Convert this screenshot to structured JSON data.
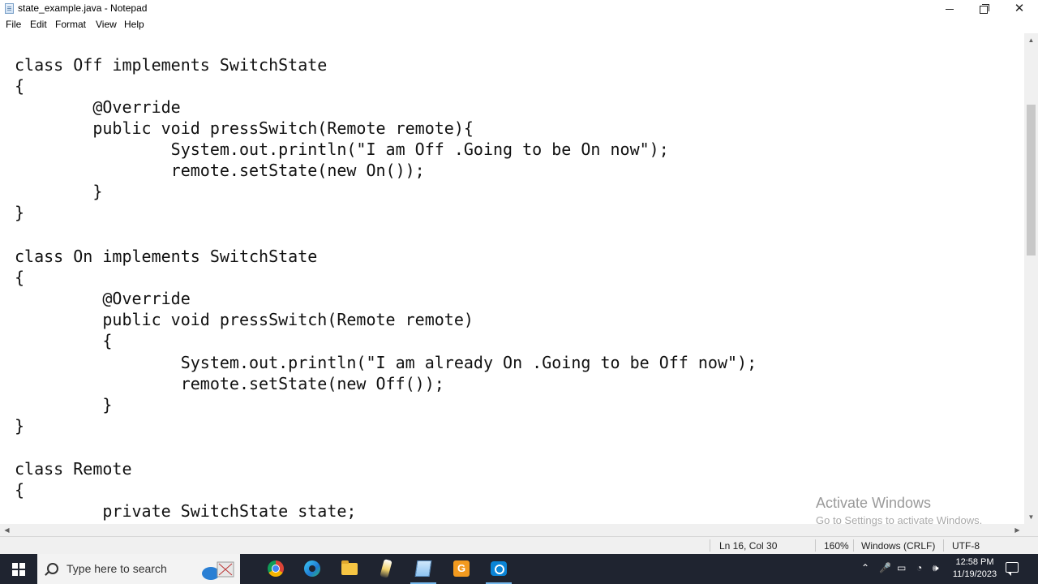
{
  "window": {
    "title": "state_example.java - Notepad",
    "minimize_icon": "minimize-icon",
    "maximize_icon": "restore-icon",
    "close_icon": "close-icon",
    "close_glyph": "✕"
  },
  "menu": {
    "file": "File",
    "edit": "Edit",
    "format": "Format",
    "view": "View",
    "help": "Help"
  },
  "editor": {
    "lines": [
      "class Off implements SwitchState",
      "{",
      "        @Override",
      "        public void pressSwitch(Remote remote){",
      "                System.out.println(\"I am Off .Going to be On now\");",
      "                remote.setState(new On());",
      "        }",
      "}",
      "",
      "class On implements SwitchState",
      "{",
      "         @Override",
      "         public void pressSwitch(Remote remote)",
      "         {",
      "                 System.out.println(\"I am already On .Going to be Off now\");",
      "                 remote.setState(new Off());",
      "         }",
      "}",
      "",
      "class Remote",
      "{",
      "         private SwitchState state;"
    ]
  },
  "watermark": {
    "title": "Activate Windows",
    "subtitle": "Go to Settings to activate Windows."
  },
  "statusbar": {
    "position": "Ln 16, Col 30",
    "zoom": "160%",
    "line_ending": "Windows (CRLF)",
    "encoding": "UTF-8"
  },
  "taskbar": {
    "search_placeholder": "Type here to search",
    "apps": [
      "chrome-icon",
      "edge-icon",
      "file-explorer-icon",
      "paint-icon",
      "notepad-icon",
      "gs-app-icon",
      "camera-icon"
    ],
    "gs_label": "G",
    "clock_time": "12:58 PM",
    "clock_date": "11/19/2023",
    "tray": {
      "chevron": "⌃",
      "mic": "🎤",
      "network": "▭",
      "wifi": "◔",
      "volume": "🕪"
    }
  }
}
